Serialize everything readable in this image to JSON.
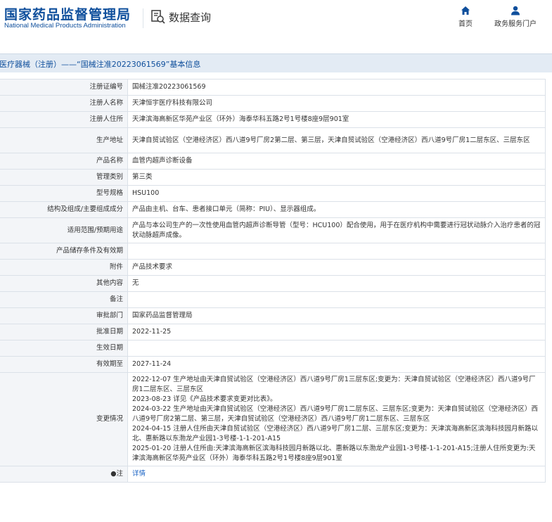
{
  "header": {
    "logo_cn": "国家药品监督管理局",
    "logo_en": "National Medical Products Administration",
    "query_title": "数据查询",
    "nav": [
      {
        "label": "首页",
        "icon": "home-icon"
      },
      {
        "label": "政务服务门户",
        "icon": "user-icon"
      }
    ]
  },
  "breadcrumb": "医疗器械（注册）——“国械注准20223061569”基本信息",
  "colors": {
    "brand": "#0f4f9c",
    "crumb_bg": "#e3ebf4",
    "key_bg": "#f3f5f8",
    "border": "#dbe1e8",
    "link": "#1a63c4"
  },
  "rows": [
    {
      "key": "注册证编号",
      "value": "国械注准20223061569"
    },
    {
      "key": "注册人名称",
      "value": "天津恒宇医疗科技有限公司"
    },
    {
      "key": "注册人住所",
      "value": "天津滨海高新区华苑产业区（环外）海泰华科五路2号1号楼8座9层901室"
    },
    {
      "key": "生产地址",
      "value": "天津自贸试验区（空港经济区）西八道9号厂房2第二层、第三层，天津自贸试验区（空港经济区）西八道9号厂房1二层东区、三层东区"
    },
    {
      "key": "产品名称",
      "value": "血管内超声诊断设备"
    },
    {
      "key": "管理类别",
      "value": "第三类"
    },
    {
      "key": "型号规格",
      "value": "HSU100"
    },
    {
      "key": "结构及组成/主要组成成分",
      "value": "产品由主机、台车、患者接口单元（简称：PIU）、显示器组成。"
    },
    {
      "key": "适用范围/预期用途",
      "value": "产品与本公司生产的一次性使用血管内超声诊断导管（型号：HCU100）配合使用，用于在医疗机构中需要进行冠状动脉介入治疗患者的冠状动脉超声成像。"
    },
    {
      "key": "产品储存条件及有效期",
      "value": ""
    },
    {
      "key": "附件",
      "value": "产品技术要求"
    },
    {
      "key": "其他内容",
      "value": "无"
    },
    {
      "key": "备注",
      "value": ""
    },
    {
      "key": "审批部门",
      "value": "国家药品监督管理局"
    },
    {
      "key": "批准日期",
      "value": "2022-11-25"
    },
    {
      "key": "生效日期",
      "value": ""
    },
    {
      "key": "有效期至",
      "value": "2027-11-24"
    }
  ],
  "changes": {
    "key": "变更情况",
    "lines": [
      "2022-12-07 生产地址由天津自贸试验区（空港经济区）西八道9号厂房1三层东区;变更为：天津自贸试验区（空港经济区）西八道9号厂房1二层东区、三层东区",
      "2023-08-23 详见《产品技术要求变更对比表》。",
      "2024-03-22 生产地址由天津自贸试验区（空港经济区）西八道9号厂房1二层东区、三层东区;变更为：天津自贸试验区（空港经济区）西八道9号厂房2第二层、第三层，天津自贸试验区（空港经济区）西八道9号厂房1二层东区、三层东区",
      "2024-04-15 注册人住所由天津自贸试验区（空港经济区）西八道9号厂房1二层、三层东区;变更为：天津滨海高新区滨海科技园月新路以北、惠新路以东渤龙产业园1-3号楼-1-1-201-A15",
      "2025-01-20 注册人住所由:天津滨海高新区滨海科技园月新路以北、惠新路以东渤龙产业园1-3号楼-1-1-201-A15;注册人住所变更为:天津滨海高新区华苑产业区（环外）海泰华科五路2号1号楼8座9层901室"
    ]
  },
  "note": {
    "key": "●注",
    "link": "详情"
  }
}
